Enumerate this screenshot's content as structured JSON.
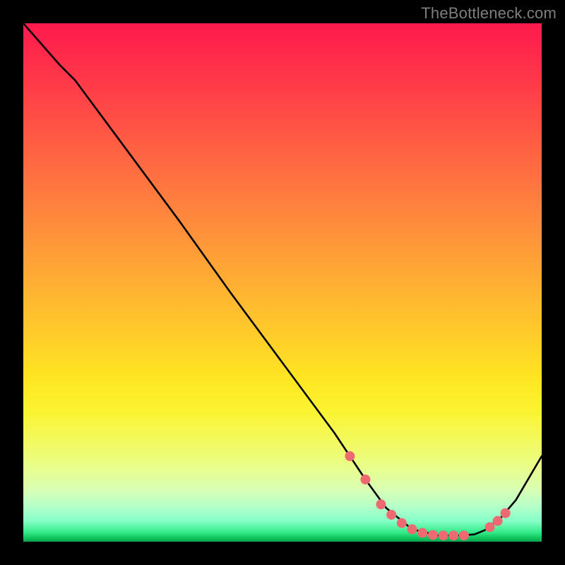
{
  "watermark": "TheBottleneck.com",
  "chart_data": {
    "type": "line",
    "title": "",
    "xlabel": "",
    "ylabel": "",
    "xlim": [
      0,
      100
    ],
    "ylim": [
      0,
      100
    ],
    "grid": false,
    "series": [
      {
        "name": "curve",
        "x": [
          0,
          7,
          10,
          20,
          30,
          40,
          50,
          60,
          64,
          66,
          70,
          75,
          80,
          84,
          87,
          89,
          92,
          95,
          100
        ],
        "y": [
          100,
          92,
          89,
          75.5,
          62,
          48,
          34.5,
          21,
          15,
          12,
          6.5,
          2.4,
          1.2,
          1.2,
          1.4,
          2.2,
          4.5,
          8,
          16.5
        ]
      }
    ],
    "markers": {
      "name": "highlight-points",
      "color": "#ed6a72",
      "radius": 7,
      "x": [
        63,
        66,
        69,
        71,
        73,
        75,
        77,
        79,
        81,
        83,
        85,
        90,
        91.5,
        93
      ],
      "y": [
        16.5,
        12,
        7.2,
        5.2,
        3.6,
        2.4,
        1.7,
        1.3,
        1.2,
        1.2,
        1.2,
        2.8,
        4.0,
        5.5
      ]
    },
    "background_gradient": {
      "top": "#ff1a4d",
      "mid": "#ffe722",
      "bottom": "#0aa349"
    }
  }
}
